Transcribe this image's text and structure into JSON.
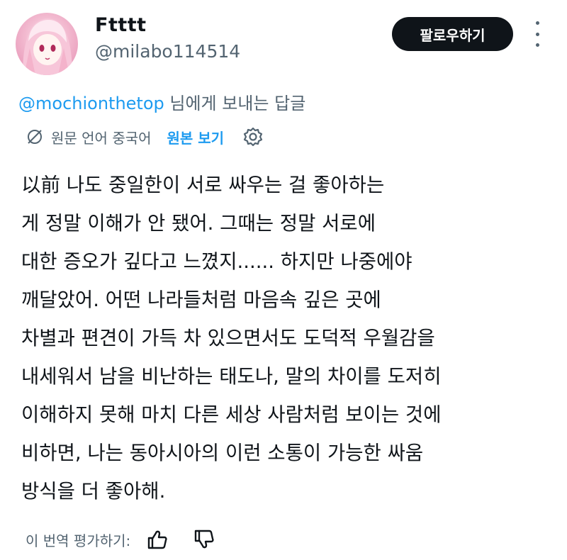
{
  "author": {
    "display_name": "Ftttt",
    "handle": "@milabo114514"
  },
  "follow_button": {
    "label": "팔로우하기"
  },
  "reply_context": {
    "mention": "@mochionthetop",
    "suffix": " 님에게 보내는 답글"
  },
  "translation": {
    "original_language": "원문 언어 중국어",
    "show_original": "원본 보기"
  },
  "body_lines": [
    "以前 나도 중일한이 서로 싸우는 걸 좋아하는",
    "게 정말 이해가 안 됐어. 그때는 정말 서로에",
    "대한 증오가 깊다고 느꼈지...... 하지만 나중에야",
    "깨달았어. 어떤 나라들처럼 마음속 깊은 곳에",
    "차별과 편견이 가득 차 있으면서도 도덕적 우월감을",
    "내세워서 남을 비난하는 태도나, 말의 차이를 도저히",
    "이해하지 못해 마치 다른 세상 사람처럼 보이는 것에",
    "비하면, 나는 동아시아의 이런 소통이 가능한 싸움",
    "방식을 더 좋아해."
  ],
  "rating": {
    "label": "이 번역 평가하기:"
  },
  "colors": {
    "accent": "#1d9bf0",
    "text": "#0f1419",
    "muted": "#536471",
    "button_bg": "#0f1419"
  },
  "icons": [
    "avatar-image",
    "more-icon",
    "translate-icon",
    "gear-icon",
    "thumbs-up-icon",
    "thumbs-down-icon"
  ]
}
